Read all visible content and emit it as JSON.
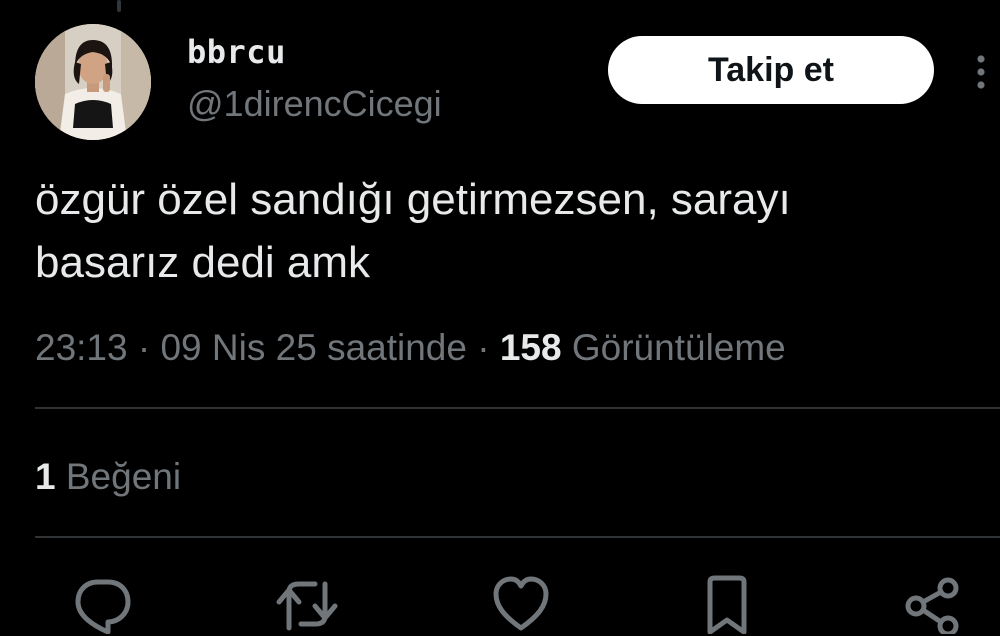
{
  "author": {
    "display_name": "bbrcu",
    "handle": "@1direncCicegi"
  },
  "follow_button": {
    "label": "Takip et"
  },
  "more_menu": {
    "icon": "more-vertical-icon"
  },
  "tweet": {
    "text_line_1": "özgür özel sandığı getirmezsen, sarayı",
    "text_line_2": "basarız dedi amk"
  },
  "meta": {
    "time": "23:13",
    "separator": "·",
    "date": "09 Nis 25 saatinde",
    "views_count": "158",
    "views_label": "Görüntüleme"
  },
  "engagement": {
    "likes_count": "1",
    "likes_label": "Beğeni"
  },
  "actions": [
    {
      "name": "reply",
      "icon": "reply-icon"
    },
    {
      "name": "retweet",
      "icon": "retweet-icon"
    },
    {
      "name": "like",
      "icon": "heart-icon"
    },
    {
      "name": "bookmark",
      "icon": "bookmark-icon"
    },
    {
      "name": "share",
      "icon": "share-icon"
    }
  ],
  "colors": {
    "background": "#000000",
    "primary_text": "#e7e9ea",
    "secondary_text": "#71767b",
    "divider": "#2f3336",
    "follow_button_bg": "#ffffff",
    "follow_button_text": "#0f1419"
  }
}
